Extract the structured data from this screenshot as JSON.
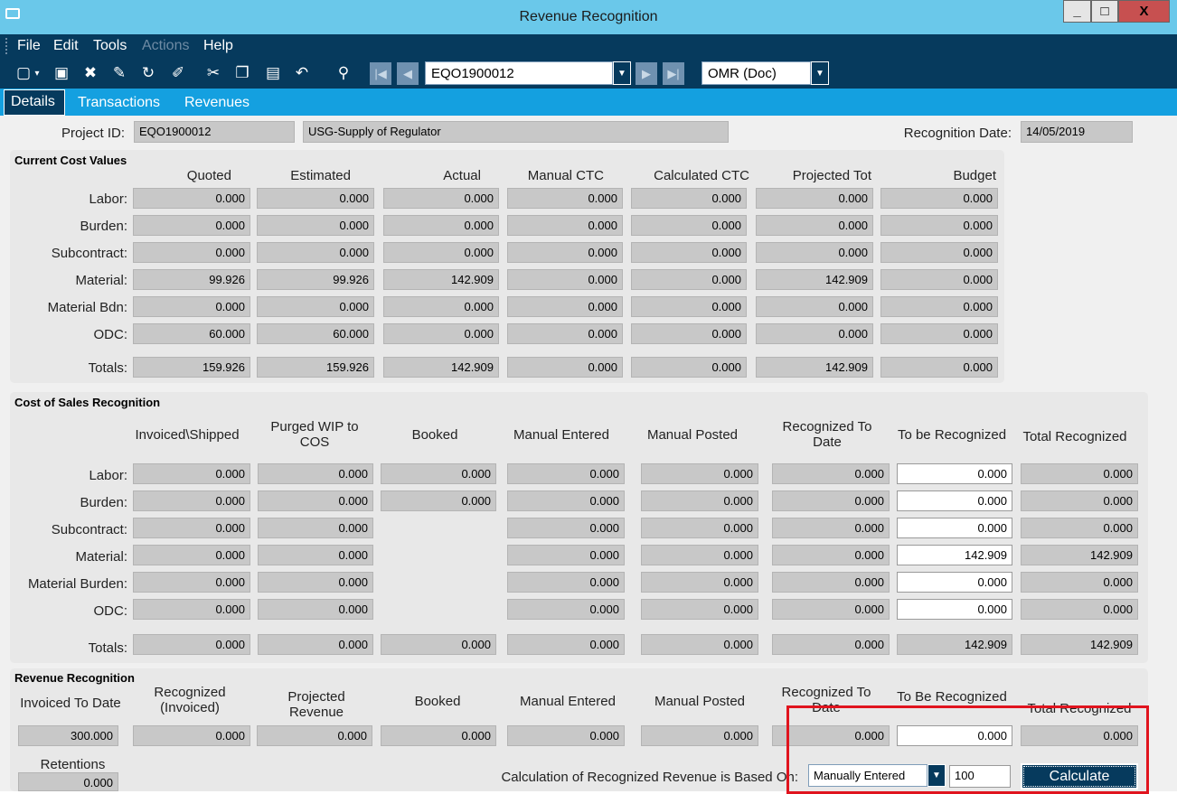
{
  "window": {
    "title": "Revenue Recognition",
    "minimize": "_",
    "maximize": "□",
    "close": "X"
  },
  "menu": [
    {
      "label": "File",
      "enabled": true
    },
    {
      "label": "Edit",
      "enabled": true
    },
    {
      "label": "Tools",
      "enabled": true
    },
    {
      "label": "Actions",
      "enabled": false
    },
    {
      "label": "Help",
      "enabled": true
    }
  ],
  "toolbar": {
    "record_value": "EQO1900012",
    "currency_value": "OMR (Doc)"
  },
  "tabs": [
    {
      "label": "Details",
      "active": true
    },
    {
      "label": "Transactions",
      "active": false
    },
    {
      "label": "Revenues",
      "active": false
    }
  ],
  "header": {
    "project_id_label": "Project ID:",
    "project_id": "EQO1900012",
    "project_desc": "USG-Supply of Regulator",
    "recognition_date_label": "Recognition Date:",
    "recognition_date": "14/05/2019"
  },
  "current_cost": {
    "title": "Current Cost Values",
    "columns": [
      "Quoted",
      "Estimated",
      "Actual",
      "Manual CTC",
      "Calculated CTC",
      "Projected Tot",
      "Budget"
    ],
    "rows": [
      {
        "label": "Labor:",
        "values": [
          "0.000",
          "0.000",
          "0.000",
          "0.000",
          "0.000",
          "0.000",
          "0.000"
        ]
      },
      {
        "label": "Burden:",
        "values": [
          "0.000",
          "0.000",
          "0.000",
          "0.000",
          "0.000",
          "0.000",
          "0.000"
        ]
      },
      {
        "label": "Subcontract:",
        "values": [
          "0.000",
          "0.000",
          "0.000",
          "0.000",
          "0.000",
          "0.000",
          "0.000"
        ]
      },
      {
        "label": "Material:",
        "values": [
          "99.926",
          "99.926",
          "142.909",
          "0.000",
          "0.000",
          "142.909",
          "0.000"
        ]
      },
      {
        "label": "Material Bdn:",
        "values": [
          "0.000",
          "0.000",
          "0.000",
          "0.000",
          "0.000",
          "0.000",
          "0.000"
        ]
      },
      {
        "label": "ODC:",
        "values": [
          "60.000",
          "60.000",
          "0.000",
          "0.000",
          "0.000",
          "0.000",
          "0.000"
        ]
      }
    ],
    "totals": {
      "label": "Totals:",
      "values": [
        "159.926",
        "159.926",
        "142.909",
        "0.000",
        "0.000",
        "142.909",
        "0.000"
      ]
    }
  },
  "cost_sales": {
    "title": "Cost of Sales Recognition",
    "columns": [
      "Invoiced\\Shipped",
      "Purged WIP to COS",
      "Booked",
      "Manual Entered",
      "Manual Posted",
      "Recognized To Date",
      "To be Recognized",
      "Total Recognized"
    ],
    "rows": [
      {
        "label": "Labor:",
        "values": [
          "0.000",
          "0.000",
          "0.000",
          "0.000",
          "0.000",
          "0.000",
          "0.000",
          "0.000"
        ]
      },
      {
        "label": "Burden:",
        "values": [
          "0.000",
          "0.000",
          "0.000",
          "0.000",
          "0.000",
          "0.000",
          "0.000",
          "0.000"
        ]
      },
      {
        "label": "Subcontract:",
        "values": [
          "0.000",
          "0.000",
          null,
          "0.000",
          "0.000",
          "0.000",
          "0.000",
          "0.000"
        ]
      },
      {
        "label": "Material:",
        "values": [
          "0.000",
          "0.000",
          null,
          "0.000",
          "0.000",
          "0.000",
          "142.909",
          "142.909"
        ]
      },
      {
        "label": "Material Burden:",
        "values": [
          "0.000",
          "0.000",
          null,
          "0.000",
          "0.000",
          "0.000",
          "0.000",
          "0.000"
        ]
      },
      {
        "label": "ODC:",
        "values": [
          "0.000",
          "0.000",
          null,
          "0.000",
          "0.000",
          "0.000",
          "0.000",
          "0.000"
        ]
      }
    ],
    "totals": {
      "label": "Totals:",
      "values": [
        "0.000",
        "0.000",
        "0.000",
        "0.000",
        "0.000",
        "0.000",
        "142.909",
        "142.909"
      ]
    }
  },
  "revenue": {
    "title": "Revenue Recognition",
    "columns": [
      "Invoiced To Date",
      "Recognized (Invoiced)",
      "Projected Revenue",
      "Booked",
      "Manual Entered",
      "Manual Posted",
      "Recognized To Date",
      "To Be Recognized",
      "Total Recognized"
    ],
    "values": [
      "300.000",
      "0.000",
      "0.000",
      "0.000",
      "0.000",
      "0.000",
      "0.000",
      "0.000",
      "0.000"
    ],
    "retentions_label": "Retentions",
    "retentions_value": "0.000",
    "calc_basis_label": "Calculation of Recognized Revenue is Based On:",
    "calc_basis_value": "Manually Entered",
    "percent_value": "100",
    "calculate_label": "Calculate"
  }
}
